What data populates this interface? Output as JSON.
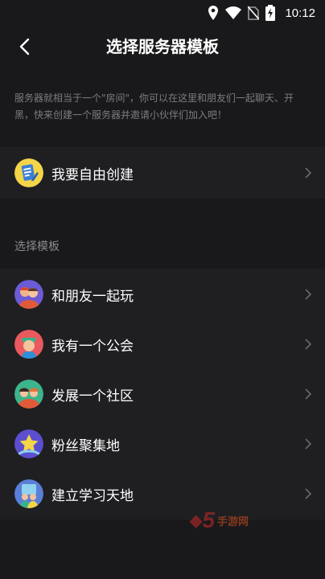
{
  "status_bar": {
    "time": "10:12",
    "icons": [
      "location-icon",
      "wifi-icon",
      "no-sim-icon",
      "battery-charging-icon"
    ]
  },
  "header": {
    "title": "选择服务器模板",
    "back_icon": "chevron-left-icon"
  },
  "description": "服务器就相当于一个\"房间\"，你可以在这里和朋友们一起聊天、开黑，快来创建一个服务器并邀请小伙伴们加入吧！",
  "custom_create": {
    "label": "我要自由创建",
    "icon": "document-edit-icon"
  },
  "templates_section": {
    "label": "选择模板",
    "items": [
      {
        "label": "和朋友一起玩",
        "icon": "friends-icon"
      },
      {
        "label": "我有一个公会",
        "icon": "guild-icon"
      },
      {
        "label": "发展一个社区",
        "icon": "community-icon"
      },
      {
        "label": "粉丝聚集地",
        "icon": "fans-star-icon"
      },
      {
        "label": "建立学习天地",
        "icon": "study-icon"
      }
    ]
  },
  "watermark": {
    "text": "手游网",
    "mark": "5"
  },
  "colors": {
    "background": "#19191b",
    "row_background": "#1f1f22",
    "text_primary": "#ffffff",
    "text_secondary": "#7c7c82"
  }
}
